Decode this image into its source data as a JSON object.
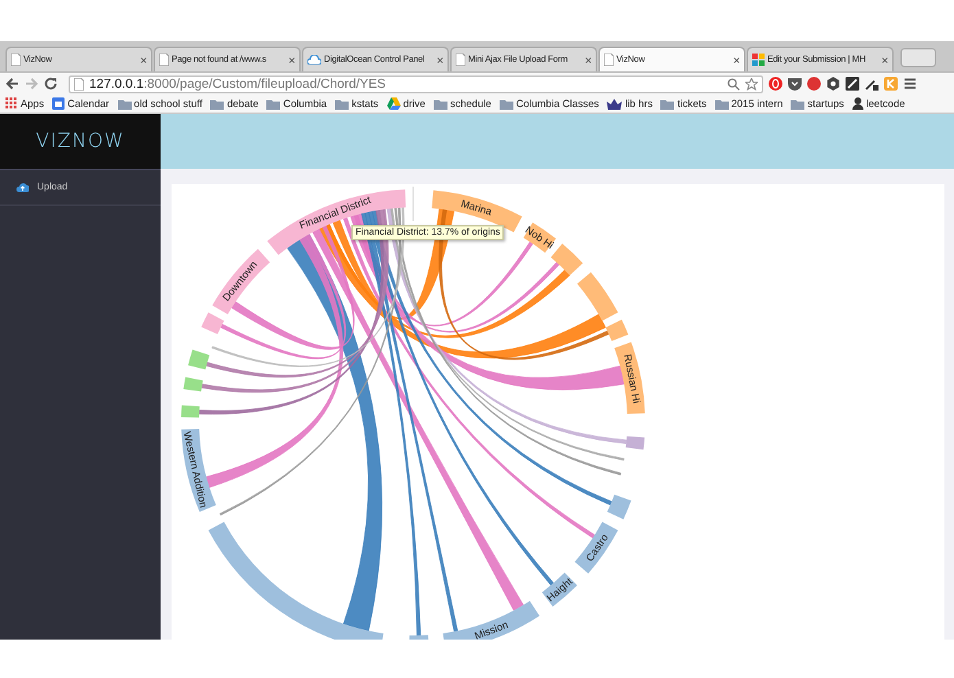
{
  "browser": {
    "tabs": [
      {
        "title": "VizNow",
        "selected": false,
        "kind": "page"
      },
      {
        "title": "Page not found at /www.s",
        "selected": false,
        "kind": "page"
      },
      {
        "title": "DigitalOcean Control Panel",
        "selected": false,
        "kind": "cloud"
      },
      {
        "title": "Mini Ajax File Upload Form",
        "selected": false,
        "kind": "page"
      },
      {
        "title": "VizNow",
        "selected": true,
        "kind": "page"
      },
      {
        "title": "Edit your Submission | MH",
        "selected": false,
        "kind": "colorful"
      }
    ],
    "close_glyph": "×",
    "url": "**127.0.0.1**:8000/page/Custom/fileupload/Chord/YES",
    "bookmarks": [
      {
        "label": "Apps",
        "kind": "apps"
      },
      {
        "label": "Calendar",
        "kind": "calendar"
      },
      {
        "label": "old school stuff",
        "kind": "folder"
      },
      {
        "label": "debate",
        "kind": "folder"
      },
      {
        "label": "Columbia",
        "kind": "folder"
      },
      {
        "label": "kstats",
        "kind": "folder"
      },
      {
        "label": "drive",
        "kind": "drive"
      },
      {
        "label": "schedule",
        "kind": "folder"
      },
      {
        "label": "Columbia Classes",
        "kind": "folder"
      },
      {
        "label": "lib hrs",
        "kind": "crown"
      },
      {
        "label": "tickets",
        "kind": "folder"
      },
      {
        "label": "2015 intern",
        "kind": "folder"
      },
      {
        "label": "startups",
        "kind": "folder"
      },
      {
        "label": "leetcode",
        "kind": "person"
      }
    ]
  },
  "app": {
    "logo": "VIZNOW",
    "sidebar": {
      "items": [
        {
          "label": "Upload",
          "selected": false
        }
      ]
    },
    "chord": {
      "tooltip": "Financial District: 13.7% of origins",
      "groups": [
        {
          "label": "Marina",
          "color": "#ffbb78"
        },
        {
          "label": "Nob Hi",
          "color": "#ffbb78"
        },
        {
          "color": "#ffbb78"
        },
        {
          "color": "#ffbb78"
        },
        {
          "color": "#ffbb78"
        },
        {
          "label": "Russian Hi",
          "color": "#ffbb78"
        },
        {
          "color": "#c5b0d5"
        },
        {
          "color": "#9ebfdd"
        },
        {
          "label": "Castro",
          "color": "#9ebfdd"
        },
        {
          "label": "Haight",
          "color": "#9ebfdd"
        },
        {
          "label": "Mission",
          "color": "#9ebfdd"
        },
        {
          "color": "#9ebfdd"
        },
        {
          "color": "#9ebfdd"
        },
        {
          "label": "Western Addition",
          "color": "#9ebfdd"
        },
        {
          "color": "#98df8a"
        },
        {
          "color": "#98df8a"
        },
        {
          "color": "#98df8a"
        },
        {
          "color": "#f7b6d2"
        },
        {
          "label": "Downtown",
          "color": "#f7b6d2"
        },
        {
          "label": "Financial District",
          "color": "#f7b6d2"
        }
      ]
    }
  }
}
